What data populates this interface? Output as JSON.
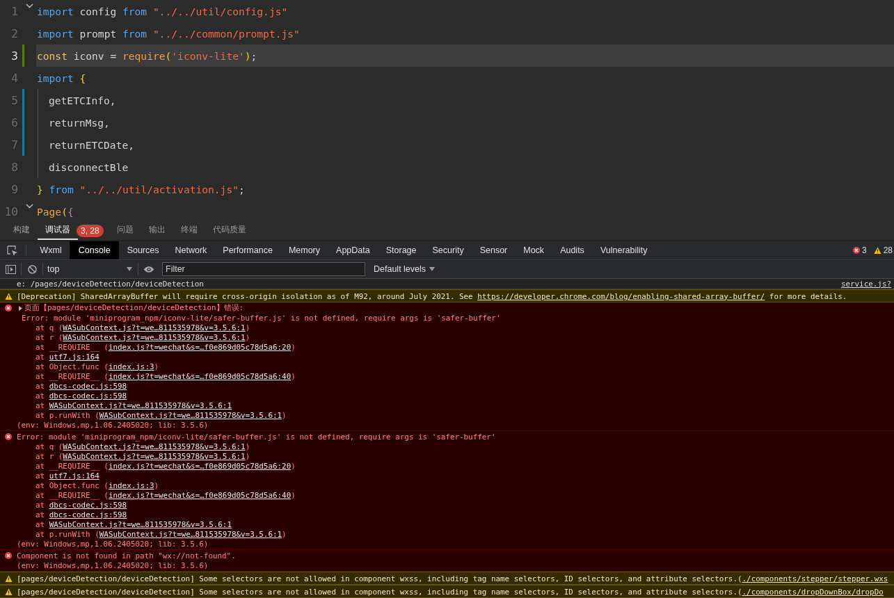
{
  "editor": {
    "lines": [
      {
        "number": "1",
        "foldable": true,
        "current": false,
        "added": false,
        "modified": false,
        "in_block": false,
        "tokens": [
          {
            "text": "import",
            "kind": "keyword"
          },
          {
            "text": " config ",
            "kind": "variable"
          },
          {
            "text": "from",
            "kind": "keyword"
          },
          {
            "text": " \"../../util/config.js\"",
            "kind": "string"
          }
        ]
      },
      {
        "number": "2",
        "foldable": false,
        "current": false,
        "added": false,
        "modified": false,
        "in_block": false,
        "tokens": [
          {
            "text": "import",
            "kind": "keyword"
          },
          {
            "text": " prompt ",
            "kind": "variable"
          },
          {
            "text": "from",
            "kind": "keyword"
          },
          {
            "text": " \"../../common/prompt.js\"",
            "kind": "string"
          }
        ]
      },
      {
        "number": "3",
        "foldable": false,
        "current": true,
        "added": true,
        "modified": false,
        "in_block": false,
        "tokens": [
          {
            "text": "const",
            "kind": "storage"
          },
          {
            "text": " iconv = ",
            "kind": "variable"
          },
          {
            "text": "require",
            "kind": "function"
          },
          {
            "text": "(",
            "kind": "bracket"
          },
          {
            "text": "'iconv-lite'",
            "kind": "string"
          },
          {
            "text": ")",
            "kind": "bracket"
          },
          {
            "text": ";",
            "kind": "variable"
          }
        ]
      },
      {
        "number": "4",
        "foldable": false,
        "current": false,
        "added": false,
        "modified": false,
        "in_block": false,
        "tokens": [
          {
            "text": "import",
            "kind": "keyword"
          },
          {
            "text": " {",
            "kind": "bracket"
          }
        ]
      },
      {
        "number": "5",
        "foldable": false,
        "current": false,
        "added": false,
        "modified": true,
        "in_block": true,
        "tokens": [
          {
            "text": "getETCInfo,",
            "kind": "variable"
          }
        ]
      },
      {
        "number": "6",
        "foldable": false,
        "current": false,
        "added": false,
        "modified": true,
        "in_block": true,
        "tokens": [
          {
            "text": "returnMsg,",
            "kind": "variable"
          }
        ]
      },
      {
        "number": "7",
        "foldable": false,
        "current": false,
        "added": false,
        "modified": true,
        "in_block": true,
        "tokens": [
          {
            "text": "returnETCDate,",
            "kind": "variable"
          }
        ]
      },
      {
        "number": "8",
        "foldable": false,
        "current": false,
        "added": false,
        "modified": false,
        "in_block": true,
        "tokens": [
          {
            "text": "disconnectBle",
            "kind": "variable"
          }
        ]
      },
      {
        "number": "9",
        "foldable": false,
        "current": false,
        "added": false,
        "modified": false,
        "in_block": false,
        "tokens": [
          {
            "text": "}",
            "kind": "bracket"
          },
          {
            "text": " from",
            "kind": "keyword"
          },
          {
            "text": " \"../../util/activation.js\"",
            "kind": "string"
          },
          {
            "text": ";",
            "kind": "variable"
          }
        ]
      },
      {
        "number": "10",
        "foldable": true,
        "current": false,
        "added": false,
        "modified": false,
        "in_block": false,
        "tokens": [
          {
            "text": "Page",
            "kind": "function"
          },
          {
            "text": "(",
            "kind": "bracket"
          },
          {
            "text": "{",
            "kind": "bracket2"
          }
        ]
      }
    ]
  },
  "panel_tabs": [
    {
      "label": "构建",
      "selected": false
    },
    {
      "label": "调试器",
      "selected": true,
      "badge": "3, 28"
    },
    {
      "label": "问题",
      "selected": false
    },
    {
      "label": "输出",
      "selected": false
    },
    {
      "label": "终端",
      "selected": false
    },
    {
      "label": "代码质量",
      "selected": false
    }
  ],
  "devtools_tabs": [
    {
      "label": "Wxml",
      "selected": false
    },
    {
      "label": "Console",
      "selected": true
    },
    {
      "label": "Sources",
      "selected": false
    },
    {
      "label": "Network",
      "selected": false
    },
    {
      "label": "Performance",
      "selected": false
    },
    {
      "label": "Memory",
      "selected": false
    },
    {
      "label": "AppData",
      "selected": false
    },
    {
      "label": "Storage",
      "selected": false
    },
    {
      "label": "Security",
      "selected": false
    },
    {
      "label": "Sensor",
      "selected": false
    },
    {
      "label": "Mock",
      "selected": false
    },
    {
      "label": "Audits",
      "selected": false
    },
    {
      "label": "Vulnerability",
      "selected": false
    }
  ],
  "counters": {
    "errors": "3",
    "warnings": "28"
  },
  "toolbar": {
    "context": "top",
    "filter_placeholder": "Filter",
    "levels": "Default levels"
  },
  "console": {
    "messages": [
      {
        "kind": "log",
        "lines": [
          {
            "kind": "text",
            "before": "e: /pages/deviceDetection/deviceDetection"
          }
        ],
        "source": "service.js?"
      },
      {
        "kind": "warning",
        "lines": [
          {
            "kind": "text",
            "before": "[Deprecation] SharedArrayBuffer will require cross-origin isolation as of M92, around July 2021. See ",
            "link": "https://developer.chrome.com/blog/enabling-shared-array-buffer/",
            "after": " for more details."
          }
        ]
      },
      {
        "kind": "error",
        "expanded": false,
        "lines": [
          {
            "kind": "text",
            "before": "页面【pages/deviceDetection/deviceDetection】错误:"
          },
          {
            "kind": "detail",
            "before": "Error: module 'miniprogram_npm/iconv-lite/safer-buffer.js' is not defined, require args is 'safer-buffer'"
          },
          {
            "kind": "frame",
            "before": "at q (",
            "link": "WASubContext.js?t=we…811535978&v=3.5.6:1",
            "after": ")"
          },
          {
            "kind": "frame",
            "before": "at r (",
            "link": "WASubContext.js?t=we…811535978&v=3.5.6:1",
            "after": ")"
          },
          {
            "kind": "frame",
            "before": "at __REQUIRE__ (",
            "link": "index.js?t=wechat&s=…f0e869d05c78d5a6:20",
            "after": ")"
          },
          {
            "kind": "frame",
            "before": "at ",
            "link": "utf7.js:164"
          },
          {
            "kind": "frame",
            "before": "at Object.func (",
            "link": "index.js:3",
            "after": ")"
          },
          {
            "kind": "frame",
            "before": "at __REQUIRE__ (",
            "link": "index.js?t=wechat&s=…f0e869d05c78d5a6:40",
            "after": ")"
          },
          {
            "kind": "frame",
            "before": "at ",
            "link": "dbcs-codec.js:598"
          },
          {
            "kind": "frame",
            "before": "at ",
            "link": "dbcs-codec.js:598"
          },
          {
            "kind": "frame",
            "before": "at ",
            "link": "WASubContext.js?t=we…811535978&v=3.5.6:1"
          },
          {
            "kind": "frame",
            "before": "at p.runWith (",
            "link": "WASubContext.js?t=we…811535978&v=3.5.6:1",
            "after": ")"
          },
          {
            "kind": "text",
            "before": "(env: Windows,mp,1.06.2405020; lib: 3.5.6)"
          }
        ]
      },
      {
        "kind": "error",
        "lines": [
          {
            "kind": "text",
            "before": "Error: module 'miniprogram_npm/iconv-lite/safer-buffer.js' is not defined, require args is 'safer-buffer'"
          },
          {
            "kind": "frame",
            "before": "at q (",
            "link": "WASubContext.js?t=we…811535978&v=3.5.6:1",
            "after": ")"
          },
          {
            "kind": "frame",
            "before": "at r (",
            "link": "WASubContext.js?t=we…811535978&v=3.5.6:1",
            "after": ")"
          },
          {
            "kind": "frame",
            "before": "at __REQUIRE__ (",
            "link": "index.js?t=wechat&s=…f0e869d05c78d5a6:20",
            "after": ")"
          },
          {
            "kind": "frame",
            "before": "at ",
            "link": "utf7.js:164"
          },
          {
            "kind": "frame",
            "before": "at Object.func (",
            "link": "index.js:3",
            "after": ")"
          },
          {
            "kind": "frame",
            "before": "at __REQUIRE__ (",
            "link": "index.js?t=wechat&s=…f0e869d05c78d5a6:40",
            "after": ")"
          },
          {
            "kind": "frame",
            "before": "at ",
            "link": "dbcs-codec.js:598"
          },
          {
            "kind": "frame",
            "before": "at ",
            "link": "dbcs-codec.js:598"
          },
          {
            "kind": "frame",
            "before": "at ",
            "link": "WASubContext.js?t=we…811535978&v=3.5.6:1"
          },
          {
            "kind": "frame",
            "before": "at p.runWith (",
            "link": "WASubContext.js?t=we…811535978&v=3.5.6:1",
            "after": ")"
          },
          {
            "kind": "text",
            "before": "(env: Windows,mp,1.06.2405020; lib: 3.5.6)"
          }
        ]
      },
      {
        "kind": "error",
        "lines": [
          {
            "kind": "text",
            "before": "Component is not found in path \"wx://not-found\"."
          },
          {
            "kind": "text",
            "before": "(env: Windows,mp,1.06.2405020; lib: 3.5.6)"
          }
        ]
      },
      {
        "kind": "warning",
        "lines": [
          {
            "kind": "text",
            "before": "[pages/deviceDetection/deviceDetection] Some selectors are not allowed in component wxss, including tag name selectors, ID selectors, and attribute selectors.(",
            "link": "./components/stepper/stepper.wxs"
          }
        ]
      },
      {
        "kind": "warning",
        "lines": [
          {
            "kind": "text",
            "before": "[pages/deviceDetection/deviceDetection] Some selectors are not allowed in component wxss, including tag name selectors, ID selectors, and attribute selectors.(",
            "link": "./components/dropDownBox/dropDo"
          }
        ]
      }
    ]
  }
}
